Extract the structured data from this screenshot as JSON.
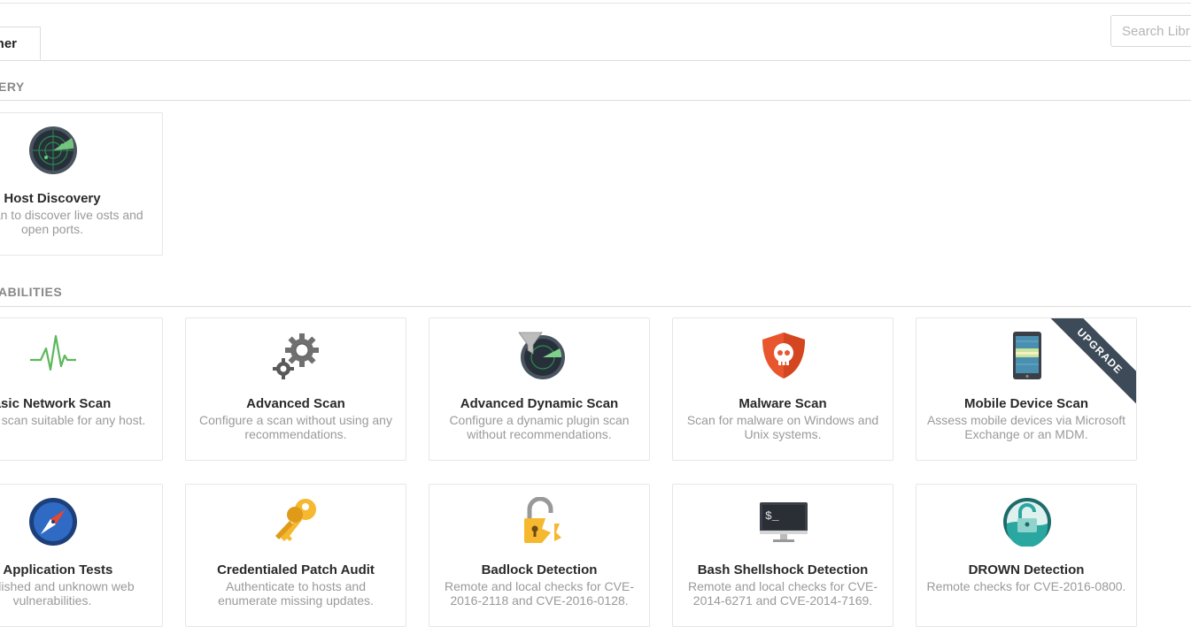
{
  "tabs": [
    {
      "label": "her"
    }
  ],
  "search": {
    "placeholder": "Search Libr"
  },
  "sections": [
    {
      "title": "ERY",
      "cards": [
        {
          "title": "Host Discovery",
          "desc": "ple scan to discover live osts and open ports.",
          "icon": "radar-icon"
        }
      ]
    },
    {
      "title": "ABILITIES",
      "cards": [
        {
          "title": "asic Network Scan",
          "desc": "system scan suitable for any host.",
          "icon": "heartbeat-icon"
        },
        {
          "title": "Advanced Scan",
          "desc": "Configure a scan without using any recommendations.",
          "icon": "gears-icon"
        },
        {
          "title": "Advanced Dynamic Scan",
          "desc": "Configure a dynamic plugin scan without recommendations.",
          "icon": "radar-filter-icon"
        },
        {
          "title": "Malware Scan",
          "desc": "Scan for malware on Windows and Unix systems.",
          "icon": "skull-shield-icon"
        },
        {
          "title": "Mobile Device Scan",
          "desc": "Assess mobile devices via Microsoft Exchange or an MDM.",
          "icon": "mobile-phone-icon",
          "badge": "UPGRADE"
        },
        {
          "title": "b Application Tests",
          "desc": "r published and unknown web vulnerabilities.",
          "icon": "compass-icon"
        },
        {
          "title": "Credentialed Patch Audit",
          "desc": "Authenticate to hosts and enumerate missing updates.",
          "icon": "keys-icon"
        },
        {
          "title": "Badlock Detection",
          "desc": "Remote and local checks for CVE-2016-2118 and CVE-2016-0128.",
          "icon": "broken-padlock-icon"
        },
        {
          "title": "Bash Shellshock Detection",
          "desc": "Remote and local checks for CVE-2014-6271 and CVE-2014-7169.",
          "icon": "terminal-monitor-icon"
        },
        {
          "title": "DROWN Detection",
          "desc": "Remote checks for CVE-2016-0800.",
          "icon": "drowning-lock-icon"
        }
      ]
    }
  ]
}
